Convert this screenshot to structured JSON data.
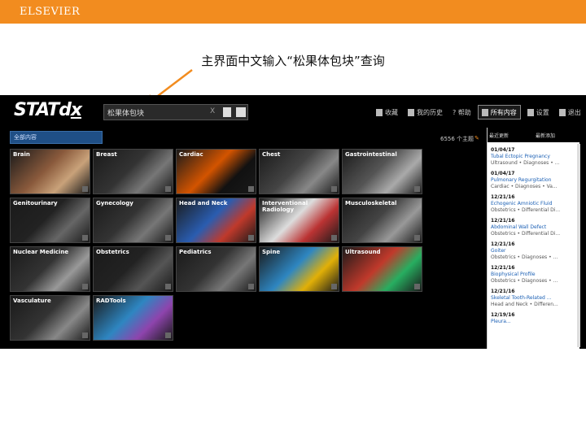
{
  "header": {
    "publisher": "ELSEVIER"
  },
  "caption": "主界面中文输入“松果体包块”查询",
  "app": {
    "logo_text": "STATd",
    "logo_mark": "x",
    "search": {
      "value": "松果体包块",
      "clear": "X"
    },
    "nav": [
      {
        "label": "收藏"
      },
      {
        "label": "我的历史"
      },
      {
        "label": "? 帮助"
      },
      {
        "label": "所有内容"
      },
      {
        "label": "设置"
      },
      {
        "label": "退出"
      }
    ],
    "breadcrumb": "全部内容",
    "total_count": "6556 个主题",
    "categories": [
      {
        "name": "Brain",
        "count": ""
      },
      {
        "name": "Breast",
        "count": ""
      },
      {
        "name": "Cardiac",
        "count": ""
      },
      {
        "name": "Chest",
        "count": ""
      },
      {
        "name": "Gastrointestinal",
        "count": ""
      },
      {
        "name": "Genitourinary",
        "count": ""
      },
      {
        "name": "Gynecology",
        "count": ""
      },
      {
        "name": "Head and Neck",
        "count": ""
      },
      {
        "name": "Interventional Radiology",
        "count": ""
      },
      {
        "name": "Musculoskeletal",
        "count": ""
      },
      {
        "name": "Nuclear Medicine",
        "count": ""
      },
      {
        "name": "Obstetrics",
        "count": ""
      },
      {
        "name": "Pediatrics",
        "count": ""
      },
      {
        "name": "Spine",
        "count": ""
      },
      {
        "name": "Ultrasound",
        "count": ""
      },
      {
        "name": "Vasculature",
        "count": ""
      },
      {
        "name": "RADTools",
        "count": ""
      }
    ],
    "side_tabs": [
      "最近更新",
      "最新添加"
    ],
    "updates": [
      {
        "date": "01/04/17",
        "title": "Tubal Ectopic Pregnancy",
        "path": "Ultrasound • Diagnoses • ..."
      },
      {
        "date": "01/04/17",
        "title": "Pulmonary Regurgitation",
        "path": "Cardiac • Diagnoses • Va..."
      },
      {
        "date": "12/21/16",
        "title": "Echogenic Amniotic Fluid",
        "path": "Obstetrics • Differential Di..."
      },
      {
        "date": "12/21/16",
        "title": "Abdominal Wall Defect",
        "path": "Obstetrics • Differential Di..."
      },
      {
        "date": "12/21/16",
        "title": "Goiter",
        "path": "Obstetrics • Diagnoses • ..."
      },
      {
        "date": "12/21/16",
        "title": "Biophysical Profile",
        "path": "Obstetrics • Diagnoses • ..."
      },
      {
        "date": "12/21/16",
        "title": "Skeletal Tooth-Related ...",
        "path": "Head and Neck • Differen..."
      },
      {
        "date": "12/19/16",
        "title": "Pleura...",
        "path": ""
      }
    ]
  },
  "colors": {
    "brand": "#f28c1f",
    "link": "#1a5fb4",
    "app_bg": "#000000"
  }
}
